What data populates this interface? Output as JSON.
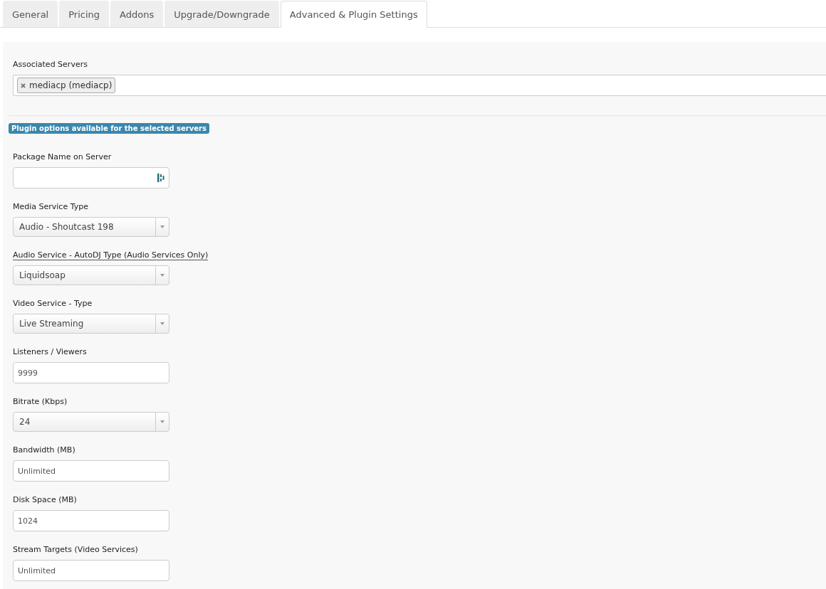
{
  "tabs": [
    {
      "label": "General",
      "selected": false
    },
    {
      "label": "Pricing",
      "selected": false
    },
    {
      "label": "Addons",
      "selected": false
    },
    {
      "label": "Upgrade/Downgrade",
      "selected": false
    },
    {
      "label": "Advanced & Plugin Settings",
      "selected": true
    }
  ],
  "associated_servers": {
    "label": "Associated Servers",
    "tags": [
      "mediacp (mediacp)"
    ]
  },
  "plugin_notice": "Plugin options available for the selected servers",
  "fields": [
    {
      "kind": "text",
      "label": "Package Name on Server",
      "underlined": false,
      "has_icon": true
    },
    {
      "kind": "select",
      "label": "Media Service Type",
      "value": "Audio - Shoutcast 198",
      "underlined": false
    },
    {
      "kind": "select",
      "label": "Audio Service - AutoDJ Type (Audio Services Only)",
      "value": "Liquidsoap",
      "underlined": true
    },
    {
      "kind": "select",
      "label": "Video Service - Type",
      "value": "Live Streaming",
      "underlined": false
    },
    {
      "kind": "text",
      "label": "Listeners / Viewers",
      "value": "9999",
      "underlined": false
    },
    {
      "kind": "select",
      "label": "Bitrate (Kbps)",
      "value": "24",
      "underlined": false
    },
    {
      "kind": "text",
      "label": "Bandwidth (MB)",
      "value": "Unlimited",
      "underlined": false
    },
    {
      "kind": "text",
      "label": "Disk Space (MB)",
      "value": "1024",
      "underlined": false
    },
    {
      "kind": "text",
      "label": "Stream Targets (Video Services)",
      "value": "Unlimited",
      "underlined": false
    }
  ]
}
